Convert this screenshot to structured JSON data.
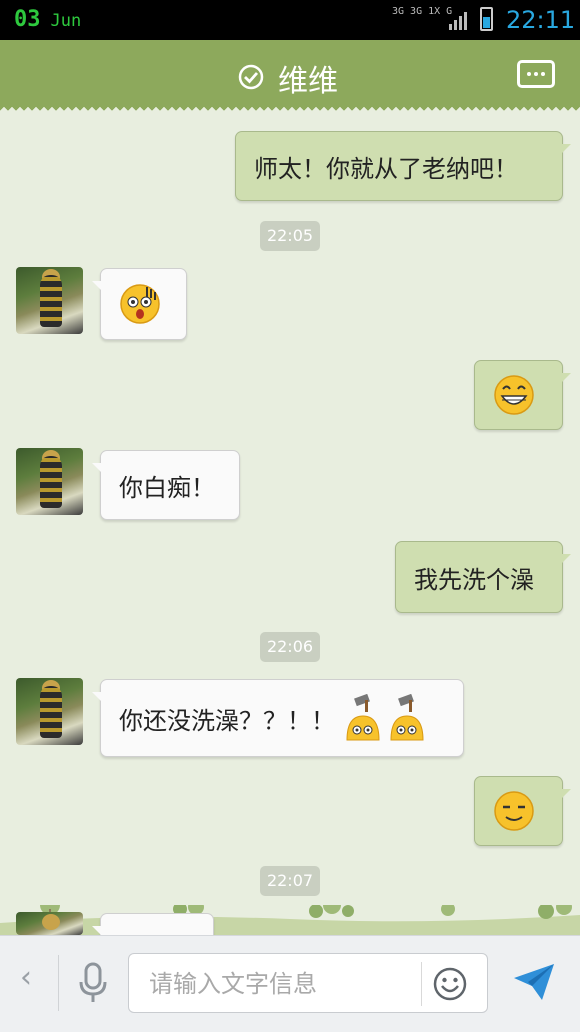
{
  "status_bar": {
    "date_day": "03",
    "date_month": "Jun",
    "network": "3G 3G 1X G",
    "time": "22:11"
  },
  "header": {
    "title": "维维"
  },
  "messages": [
    {
      "side": "right",
      "text": "师太！你就从了老纳吧！"
    },
    {
      "side": "left",
      "emoji": "shocked-emoji"
    },
    {
      "side": "right",
      "emoji": "grin-emoji"
    },
    {
      "side": "left",
      "text": "你白痴！"
    },
    {
      "side": "right",
      "text": "我先洗个澡"
    },
    {
      "side": "left",
      "text": "你还没洗澡？？！！",
      "emoji": "hammer-emoji"
    },
    {
      "side": "right",
      "emoji": "content-smile-emoji"
    }
  ],
  "timestamps": [
    "22:05",
    "22:06",
    "22:07"
  ],
  "input": {
    "placeholder": "请输入文字信息",
    "value": ""
  },
  "colors": {
    "header": "#8da95c",
    "bubble_right": "#cfdeb0",
    "bubble_left": "#fafafa",
    "background": "#e8eedf",
    "send": "#2f8fd8"
  }
}
